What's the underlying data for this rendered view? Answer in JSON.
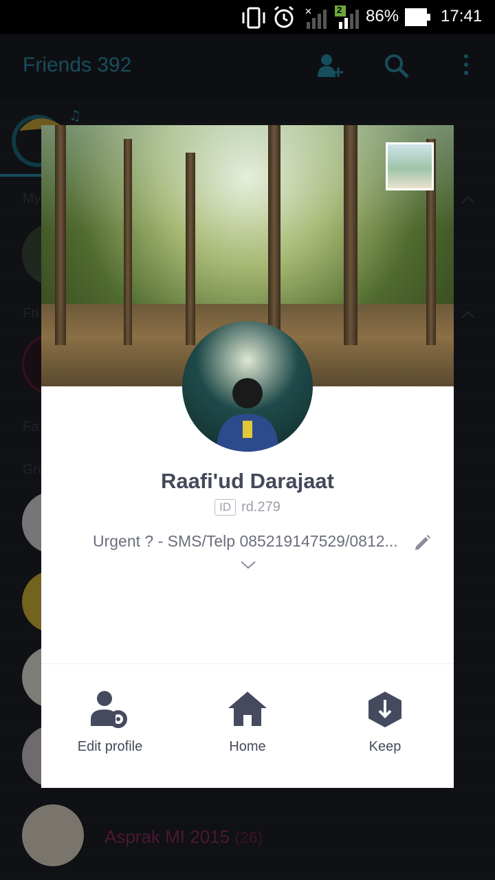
{
  "status_bar": {
    "battery_percent": "86%",
    "time": "17:41",
    "sim_badge": "2",
    "icons": [
      "vibrate-icon",
      "alarm-icon",
      "signal-muted-icon",
      "signal-icon",
      "battery-icon"
    ]
  },
  "header": {
    "title": "Friends 392",
    "icons": [
      "add-friend-icon",
      "search-icon",
      "more-vert-icon"
    ]
  },
  "background_list": {
    "group_name": "Asprak MI 2015",
    "group_count": "(26)"
  },
  "profile": {
    "name": "Raafi'ud Darajaat",
    "id_badge": "ID",
    "id_value": "rd.279",
    "status_message": "Urgent ? - SMS/Telp 085219147529/0812...",
    "actions": [
      {
        "label": "Edit profile",
        "icon": "edit-profile-icon"
      },
      {
        "label": "Home",
        "icon": "home-icon"
      },
      {
        "label": "Keep",
        "icon": "keep-icon"
      }
    ]
  },
  "colors": {
    "accent": "#2a8fa8",
    "card_bg": "#ffffff",
    "text_dark": "#44495a",
    "icon_dark": "#454a5f",
    "group_name": "#8c2a5c"
  }
}
